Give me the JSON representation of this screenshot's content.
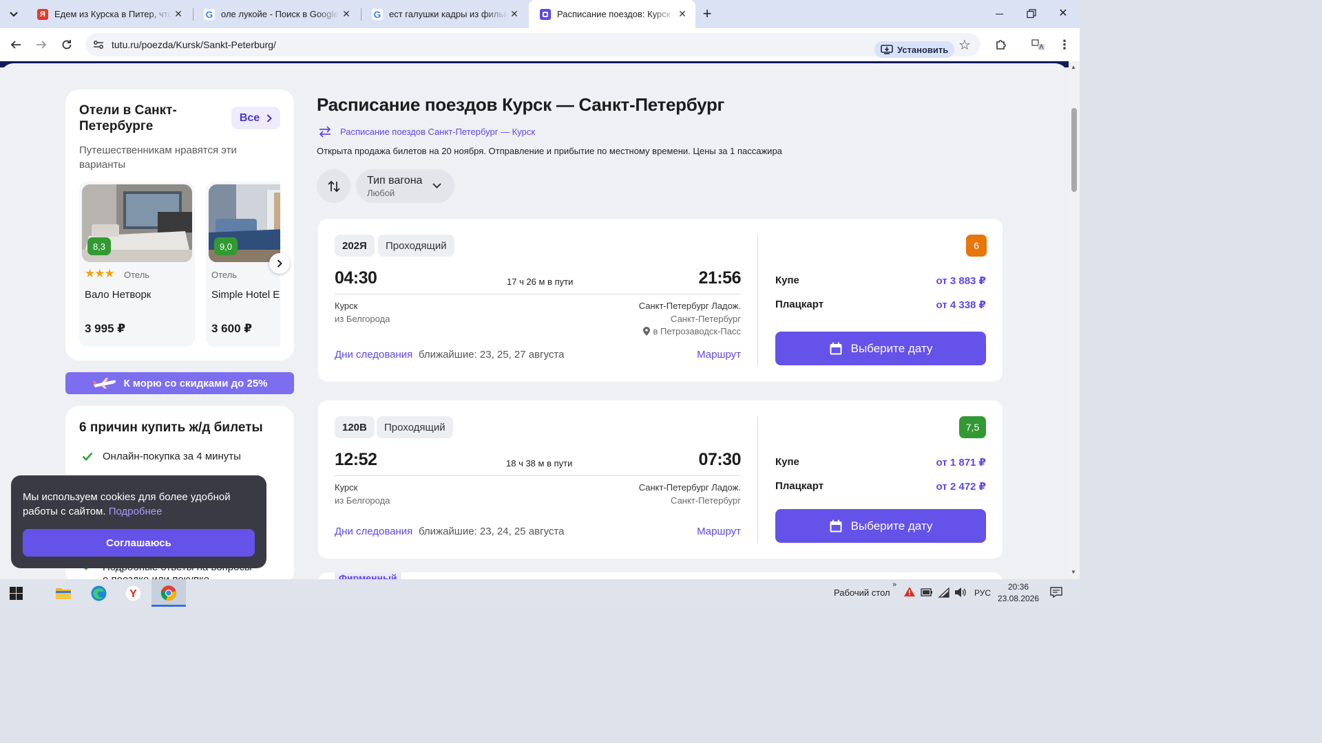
{
  "browser": {
    "tabs": [
      {
        "title": "Едем из Курска в Питер, что с",
        "favicon": "yandex-zen-icon"
      },
      {
        "title": "оле лукойе - Поиск в Google",
        "favicon": "google-icon"
      },
      {
        "title": "ест галушки кадры из фильма",
        "favicon": "google-icon"
      },
      {
        "title": "Расписание поездов: Курск —",
        "favicon": "tutu-icon"
      }
    ],
    "address": "tutu.ru/poezda/Kursk/Sankt-Peterburg/",
    "install_label": "Установить"
  },
  "hotels": {
    "title": "Отели в Санкт-Петербурге",
    "title_line1": "Отели в Санкт-",
    "title_line2": "Петербурге",
    "all_button": "Все",
    "subtitle_line1": "Путешественникам нравятся эти",
    "subtitle_line2": "варианты",
    "items": [
      {
        "score": "8,3",
        "stars": 3,
        "type": "Отель",
        "name": "Вало Нетворк",
        "price": "3 995 ₽"
      },
      {
        "score": "9,0",
        "type": "Отель",
        "name": "Simple Hotel E",
        "price": "3 600 ₽"
      }
    ]
  },
  "promo": {
    "label": "К морю со скидками до 25%"
  },
  "reasons": {
    "title": "6 причин купить ж/д билеты",
    "items": [
      "Онлайн-покупка за 4 минуты",
      "Подробные ответы на вопросы",
      "о поездке или покупке"
    ]
  },
  "cookie": {
    "text_line1": "Мы используем cookies для более удобной",
    "text_line2": "работы с сайтом.",
    "link": "Подробнее",
    "accept": "Соглашаюсь"
  },
  "schedule": {
    "title": "Расписание поездов Курск — Санкт-Петербург",
    "reverse_link": "Расписание поездов Санкт-Петербург — Курск",
    "info": "Открыта продажа билетов на 20 ноября. Отправление и прибытие по местному времени. Цены за 1 пассажира",
    "filter_label": "Тип вагона",
    "filter_value": "Любой",
    "next_tag": "Фирменный",
    "trains": [
      {
        "number": "202Я",
        "type": "Проходящий",
        "depart": "04:30",
        "duration": "17 ч 26 м в пути",
        "arrive": "21:56",
        "from_station": "Курск",
        "from_origin": "из Белгорода",
        "to_station": "Санкт-Петербург Ладож.",
        "to_city": "Санкт-Петербург",
        "to_final": "в Петрозаводск-Пасс",
        "days_label": "Дни следования",
        "days_value": "ближайшие: 23, 25, 27 августа",
        "route_label": "Маршрут",
        "rating": "6",
        "rating_color": "#e8760a",
        "classes": [
          {
            "name": "Купе",
            "price": "от 3 883 ₽"
          },
          {
            "name": "Плацкарт",
            "price": "от 4 338 ₽"
          }
        ],
        "date_button": "Выберите дату"
      },
      {
        "number": "120В",
        "type": "Проходящий",
        "depart": "12:52",
        "duration": "18 ч 38 м в пути",
        "arrive": "07:30",
        "from_station": "Курск",
        "from_origin": "из Белгорода",
        "to_station": "Санкт-Петербург Ладож.",
        "to_city": "Санкт-Петербург",
        "days_label": "Дни следования",
        "days_value": "ближайшие: 23, 24, 25 августа",
        "route_label": "Маршрут",
        "rating": "7,5",
        "rating_color": "#339933",
        "classes": [
          {
            "name": "Купе",
            "price": "от 1 871 ₽"
          },
          {
            "name": "Плацкарт",
            "price": "от 2 472 ₽"
          }
        ],
        "date_button": "Выберите дату"
      }
    ]
  },
  "taskbar": {
    "desktop_label": "Рабочий стол",
    "lang": "РУС",
    "time": "20:36",
    "date": "23.08.2026"
  }
}
